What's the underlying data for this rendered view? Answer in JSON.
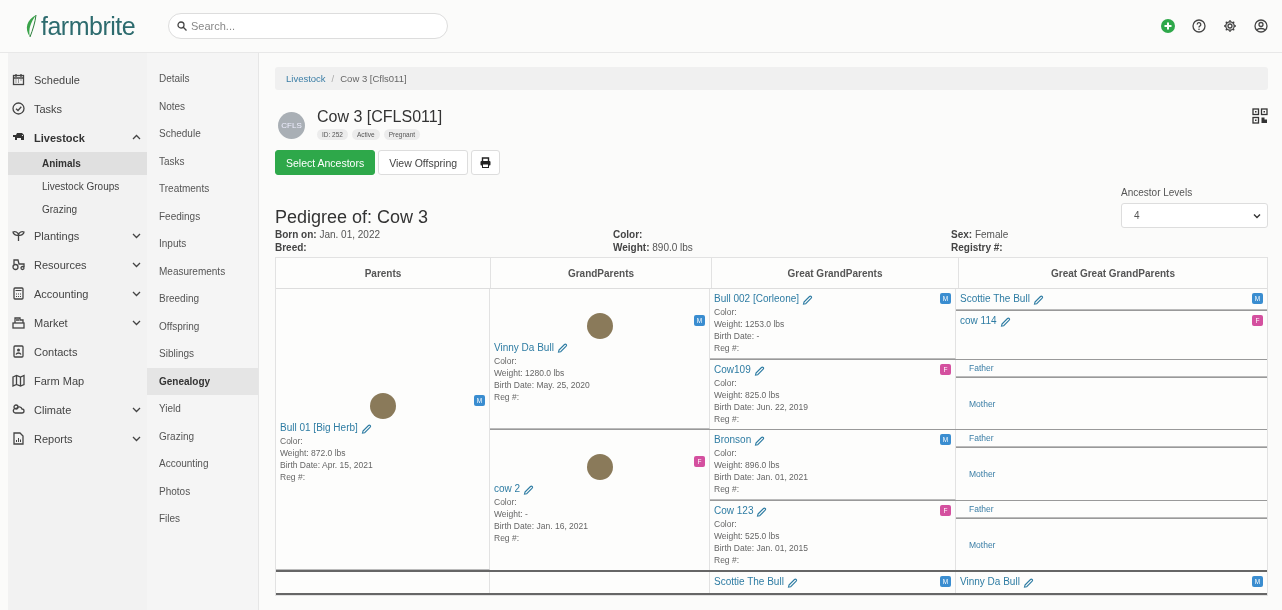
{
  "header": {
    "logo": "farmbrite",
    "search": {
      "placeholder": "Search..."
    }
  },
  "sidebar": {
    "items": [
      {
        "label": "Schedule"
      },
      {
        "label": "Tasks"
      },
      {
        "label": "Livestock",
        "expanded": true,
        "children": [
          {
            "label": "Animals",
            "selected": true
          },
          {
            "label": "Livestock Groups",
            "selected": false
          },
          {
            "label": "Grazing",
            "selected": false
          }
        ]
      },
      {
        "label": "Plantings",
        "expanded": false
      },
      {
        "label": "Resources",
        "expanded": false
      },
      {
        "label": "Accounting",
        "expanded": false
      },
      {
        "label": "Market",
        "expanded": false
      },
      {
        "label": "Contacts"
      },
      {
        "label": "Farm Map"
      },
      {
        "label": "Climate",
        "expanded": false
      },
      {
        "label": "Reports",
        "expanded": false
      }
    ]
  },
  "submenu": {
    "items": [
      {
        "label": "Details",
        "selected": false
      },
      {
        "label": "Notes",
        "selected": false
      },
      {
        "label": "Schedule",
        "selected": false
      },
      {
        "label": "Tasks",
        "selected": false
      },
      {
        "label": "Treatments",
        "selected": false
      },
      {
        "label": "Feedings",
        "selected": false
      },
      {
        "label": "Inputs",
        "selected": false
      },
      {
        "label": "Measurements",
        "selected": false
      },
      {
        "label": "Breeding",
        "selected": false
      },
      {
        "label": "Offspring",
        "selected": false
      },
      {
        "label": "Siblings",
        "selected": false
      },
      {
        "label": "Genealogy",
        "selected": true
      },
      {
        "label": "Yield",
        "selected": false
      },
      {
        "label": "Grazing",
        "selected": false
      },
      {
        "label": "Accounting",
        "selected": false
      },
      {
        "label": "Photos",
        "selected": false
      },
      {
        "label": "Files",
        "selected": false
      }
    ]
  },
  "breadcrumb": {
    "items": [
      "Livestock",
      "Cow 3 [Cfls011]"
    ],
    "separator": "/"
  },
  "animal": {
    "avatar": "CFLS",
    "title": "Cow 3 [CFLS011]",
    "badges": [
      "ID: 252",
      "Active",
      "Pregnant"
    ]
  },
  "actions": [
    {
      "label": "Select Ancestors",
      "primary": true
    },
    {
      "label": "View Offspring",
      "primary": false
    }
  ],
  "pedigree": {
    "title": "Pedigree of: Cow 3",
    "ancestor_levels": {
      "label": "Ancestor Levels",
      "value": "4"
    },
    "info": [
      [
        {
          "label": "Born on:",
          "value": "Jan. 01, 2022"
        },
        {
          "label": "Breed:"
        }
      ],
      [
        {
          "label": "Color:"
        },
        {
          "label": "Weight:",
          "value": "890.0 lbs"
        }
      ],
      [
        {
          "label": "Sex:",
          "value": "Female"
        },
        {
          "label": "Registry #:"
        }
      ]
    ],
    "columns": [
      "Parents",
      "GrandParents",
      "Great GrandParents",
      "Great Great GrandParents"
    ],
    "parents": [
      {
        "kind": "animal",
        "name": "Bull 01 [Big Herb]",
        "badge": "M",
        "color": "#3a8dd0",
        "photo": true,
        "details": [
          "Color:",
          "Weight: 872.0 lbs",
          "Birth Date: Apr. 15, 2021",
          "Reg #:"
        ],
        "children": [
          {
            "kind": "animal",
            "name": "Vinny Da Bull",
            "badge": "M",
            "color": "#3a8dd0",
            "photo": true,
            "details": [
              "Color:",
              "Weight: 1280.0 lbs",
              "Birth Date: May. 25, 2020",
              "Reg #:"
            ],
            "children": [
              {
                "kind": "animal",
                "name": "Bull 002 [Corleone]",
                "badge": "M",
                "color": "#3a8dd0",
                "details": [
                  "Color:",
                  "Weight: 1253.0 lbs",
                  "Birth Date: -",
                  "Reg #:"
                ],
                "children": [
                  {
                    "kind": "animal",
                    "name": "Scottie The Bull",
                    "badge": "M",
                    "color": "#3a8dd0"
                  },
                  {
                    "kind": "animal",
                    "name": "cow 114",
                    "badge": "F",
                    "color": "#d4509f"
                  }
                ]
              },
              {
                "kind": "animal",
                "name": "Cow109",
                "badge": "F",
                "color": "#d4509f",
                "details": [
                  "Color:",
                  "Weight: 825.0 lbs",
                  "Birth Date: Jun. 22, 2019",
                  "Reg #:"
                ],
                "children": [
                  {
                    "kind": "empty",
                    "label": "Father"
                  },
                  {
                    "kind": "empty",
                    "label": "Mother"
                  }
                ]
              }
            ]
          },
          {
            "kind": "animal",
            "name": "cow 2",
            "badge": "F",
            "color": "#d4509f",
            "photo": true,
            "details": [
              "Color:",
              "Weight: -",
              "Birth Date: Jan. 16, 2021",
              "Reg #:"
            ],
            "children": [
              {
                "kind": "animal",
                "name": "Bronson",
                "badge": "M",
                "color": "#3a8dd0",
                "details": [
                  "Color:",
                  "Weight: 896.0 lbs",
                  "Birth Date: Jan. 01, 2021",
                  "Reg #:"
                ],
                "children": [
                  {
                    "kind": "empty",
                    "label": "Father"
                  },
                  {
                    "kind": "empty",
                    "label": "Mother"
                  }
                ]
              },
              {
                "kind": "animal",
                "name": "Cow 123",
                "badge": "F",
                "color": "#d4509f",
                "details": [
                  "Color:",
                  "Weight: 525.0 lbs",
                  "Birth Date: Jan. 01, 2015",
                  "Reg #:"
                ],
                "children": [
                  {
                    "kind": "empty",
                    "label": "Father"
                  },
                  {
                    "kind": "empty",
                    "label": "Mother"
                  }
                ]
              }
            ]
          }
        ]
      },
      {
        "kind": "hidden",
        "children": [
          {
            "kind": "hidden",
            "children": [
              {
                "kind": "animal",
                "name": "Scottie The Bull",
                "badge": "M",
                "color": "#3a8dd0",
                "children": [
                  {
                    "kind": "animal",
                    "name": "Vinny Da Bull",
                    "badge": "M",
                    "color": "#3a8dd0"
                  }
                ]
              }
            ]
          }
        ]
      }
    ]
  }
}
